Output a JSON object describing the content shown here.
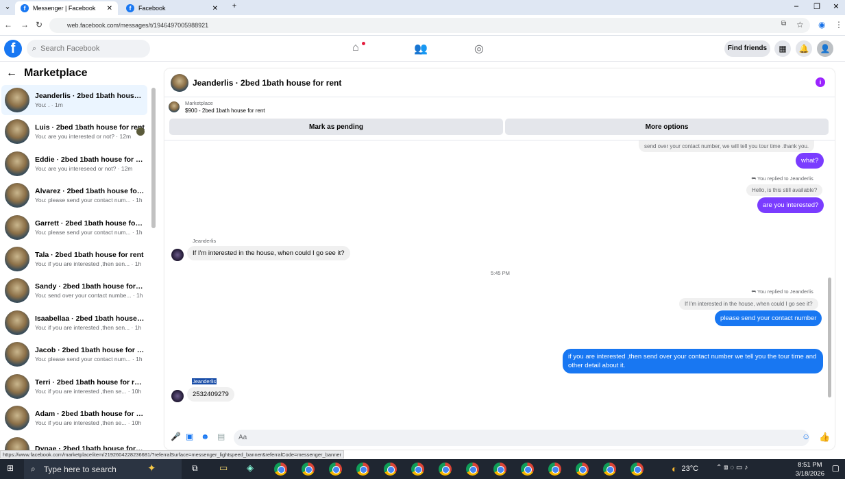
{
  "browser": {
    "tabs": [
      {
        "label": "Messenger | Facebook",
        "active": true
      },
      {
        "label": "Facebook",
        "active": false
      }
    ],
    "url": "web.facebook.com/messages/t/1946497005988921",
    "status_url": "https://www.facebook.com/marketplace/item/2192604228236681/?referralSurface=messenger_lightspeed_banner&referralCode=messenger_banner"
  },
  "header": {
    "search_placeholder": "Search Facebook",
    "find_friends": "Find friends"
  },
  "sidebar": {
    "title": "Marketplace",
    "conversations": [
      {
        "name": "Jeanderlis · 2bed 1bath house fo...",
        "preview": "You: . · 1m",
        "selected": true
      },
      {
        "name": "Luis · 2bed 1bath house for rent",
        "preview": "You: are you interested or not? · 12m"
      },
      {
        "name": "Eddie · 2bed 1bath house for rent",
        "preview": "You: are you intereseed or not? · 12m"
      },
      {
        "name": "Alvarez · 2bed 1bath house for r...",
        "preview": "You: please send your contact num... · 1h"
      },
      {
        "name": "Garrett · 2bed 1bath house for r...",
        "preview": "You: please send your contact num... · 1h"
      },
      {
        "name": "Tala · 2bed 1bath house for rent",
        "preview": "You: if you are interested ,then sen... · 1h"
      },
      {
        "name": "Sandy · 2bed 1bath house for rent",
        "preview": "You: send over your contact numbe... · 1h"
      },
      {
        "name": "Isaabellaa · 2bed 1bath house fo...",
        "preview": "You: if you are interested ,then sen... · 1h"
      },
      {
        "name": "Jacob · 2bed 1bath house for rent",
        "preview": "You: please send your contact num... · 1h"
      },
      {
        "name": "Terri · 2bed 1bath house for rent",
        "preview": "You: if you are interested ,then se... · 10h"
      },
      {
        "name": "Adam · 2bed 1bath house for rent",
        "preview": "You: if you are interested ,then se... · 10h"
      },
      {
        "name": "Dynae · 2bed 1bath house for rent",
        "preview": ""
      }
    ]
  },
  "chat": {
    "title": "Jeanderlis · 2bed 1bath house for rent",
    "marketplace_label": "Marketplace",
    "listing": "$900 - 2bed 1bath house for rent",
    "mark_pending": "Mark as pending",
    "more_options": "More options",
    "composer_placeholder": "Aa",
    "msgs": {
      "top_quote": "send over your contact number, we will tell you tour time .thank you.",
      "what": "what?",
      "replied1": "You replied to Jeanderlis",
      "quote1": "Hello, is this still available?",
      "are_you_interested": "are you interested?",
      "sender1": "Jeanderlis",
      "incoming1": "If I'm interested in the house, when could I go see it?",
      "time1": "5:45 PM",
      "replied2": "You replied to Jeanderlis",
      "quote2": "If I'm interested in the house, when could I go see it?",
      "please_send": "please send your contact number",
      "long_msg": "if you are interested ,then send over your contact number we tell you the tour time and other detail about it.",
      "sender2": "Jeanderlis",
      "incoming2": "2532409279"
    }
  },
  "taskbar": {
    "search": "Type here to search",
    "temp": "23°C",
    "time": "8:51 PM",
    "date": "3/18/2026"
  }
}
